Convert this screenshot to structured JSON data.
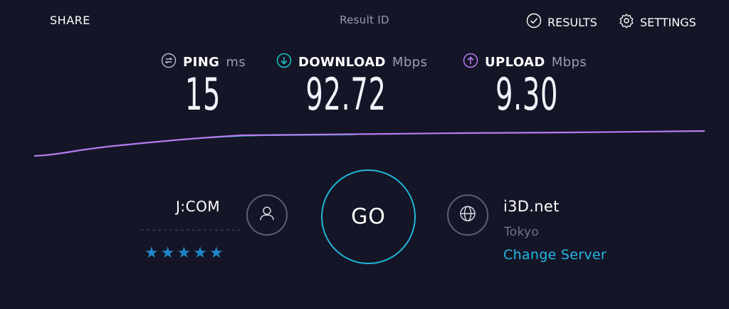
{
  "header": {
    "share_label": "SHARE",
    "result_id_label": "Result ID",
    "results_label": "RESULTS",
    "settings_label": "SETTINGS"
  },
  "metrics": {
    "ping": {
      "label": "PING",
      "unit": "ms",
      "value": "15",
      "icon": "ping-icon"
    },
    "download": {
      "label": "DOWNLOAD",
      "unit": "Mbps",
      "value": "92.72",
      "icon": "download-arrow-icon"
    },
    "upload": {
      "label": "UPLOAD",
      "unit": "Mbps",
      "value": "9.30",
      "icon": "upload-arrow-icon"
    }
  },
  "isp": {
    "name": "J:COM",
    "rating_stars": 5
  },
  "go_label": "GO",
  "server": {
    "name": "i3D.net",
    "location": "Tokyo",
    "change_label": "Change Server"
  },
  "colors": {
    "background": "#141526",
    "download_accent": "#22c0c8",
    "upload_accent": "#b57bef",
    "go_ring": "#22b4d8",
    "link": "#25b7e6",
    "stars": "#1f86c8"
  }
}
